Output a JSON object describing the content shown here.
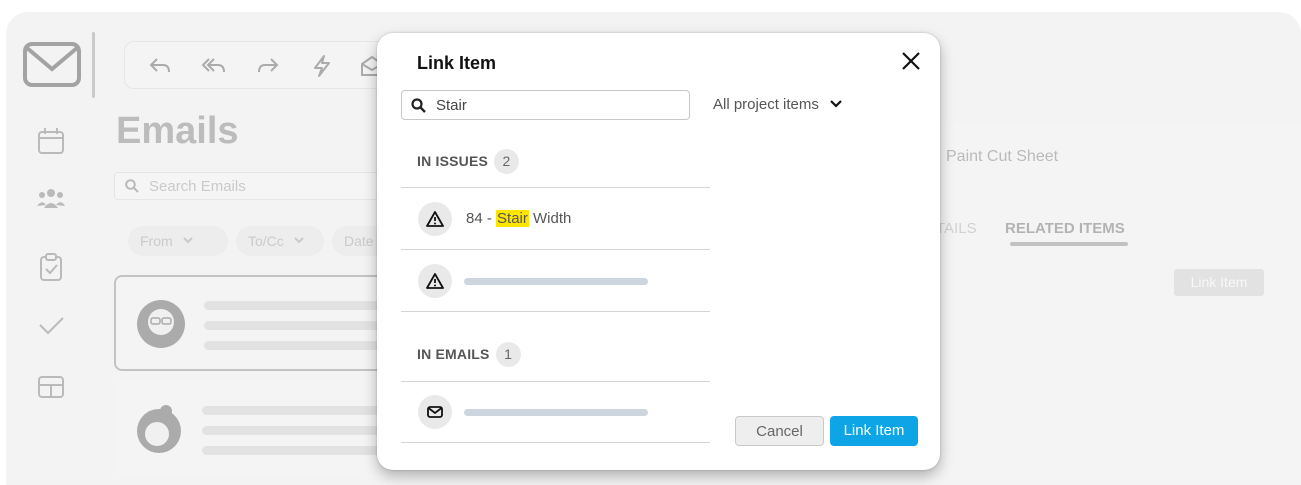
{
  "background": {
    "page_title": "Emails",
    "search_placeholder": "Search Emails",
    "filters": [
      {
        "label": "From"
      },
      {
        "label": "To/Cc"
      },
      {
        "label": "Date"
      }
    ],
    "right_panel": {
      "title": "Paint Cut Sheet",
      "tab_details_partial": "TAILS",
      "tab_related": "RELATED ITEMS",
      "link_button": "Link Item"
    }
  },
  "modal": {
    "title": "Link Item",
    "search_value": "Stair",
    "scope_label": "All project items",
    "sections": {
      "issues": {
        "label": "IN ISSUES",
        "count": "2",
        "items": [
          {
            "prefix": "84 - ",
            "match": "Stair",
            "suffix": " Width"
          }
        ]
      },
      "emails": {
        "label": "IN EMAILS",
        "count": "1"
      }
    },
    "cancel_label": "Cancel",
    "link_label": "Link Item"
  },
  "colors": {
    "primary": "#0ea5e6",
    "highlight": "#ffe600",
    "placeholder_bar": "#cdd5de"
  }
}
